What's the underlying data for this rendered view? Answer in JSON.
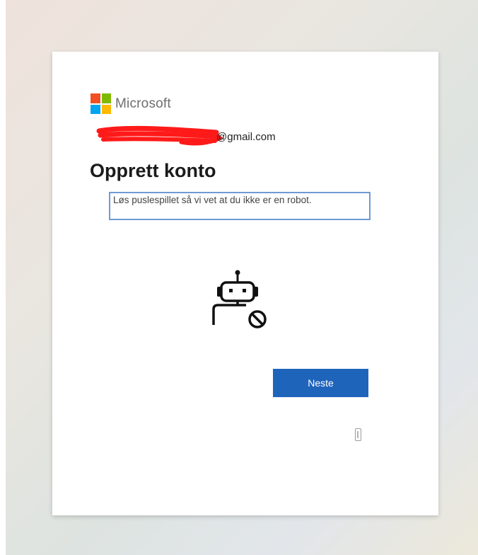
{
  "brand": {
    "name": "Microsoft",
    "logo_colors": [
      "#f25022",
      "#7fba00",
      "#00a4ef",
      "#ffb900"
    ]
  },
  "identity": {
    "email_visible": "@gmail.com",
    "redaction_color": "#ff1a1a"
  },
  "title": "Opprett konto",
  "prompt": "Løs puslespillet så vi vet at du ikke er en robot.",
  "robot_icon": "robot-blocked-icon",
  "next_button": {
    "label": "Neste",
    "color": "#1f64bb"
  },
  "footer_icon": "info-icon"
}
